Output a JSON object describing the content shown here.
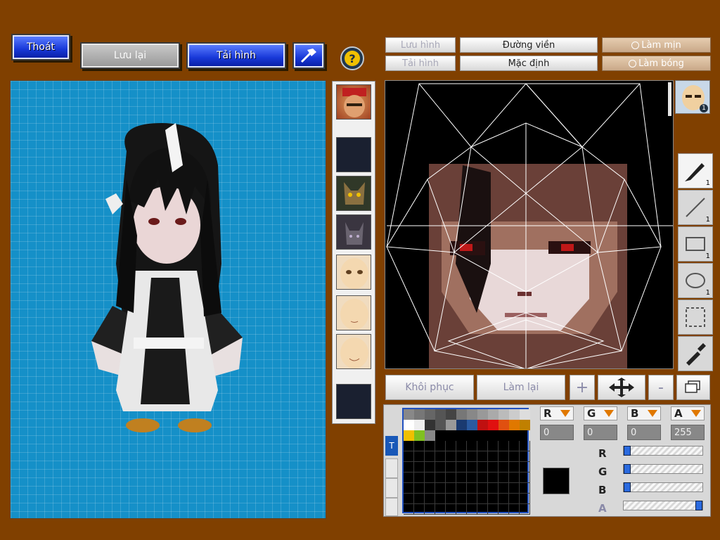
{
  "top_buttons": {
    "exit": "Thoát",
    "save": "Lưu lại",
    "load_image": "Tải hình"
  },
  "editor_toolbar": {
    "save_image": "Lưu hình",
    "load_image": "Tải hình",
    "outline": "Đường viền",
    "default": "Mặc định",
    "smooth": "Làm mịn",
    "shade": "Làm bóng"
  },
  "part_list": [
    "helmet-face",
    "empty",
    "monster-face",
    "creature-face",
    "eyes-face",
    "plain-face",
    "smile-face",
    "empty"
  ],
  "preview_badge": "1",
  "tools": [
    {
      "icon": "brush-icon",
      "count": "1"
    },
    {
      "icon": "line-icon",
      "count": "1"
    },
    {
      "icon": "rectangle-icon",
      "count": "1"
    },
    {
      "icon": "ellipse-icon",
      "count": "1"
    },
    {
      "icon": "selection-icon",
      "count": ""
    },
    {
      "icon": "eyedropper-icon",
      "count": ""
    }
  ],
  "bottom_buttons": {
    "restore": "Khôi phục",
    "redo": "Làm lại",
    "plus": "+",
    "minus": "-"
  },
  "color_channels": {
    "r_label": "R",
    "g_label": "G",
    "b_label": "B",
    "a_label": "A",
    "r_value": "0",
    "g_value": "0",
    "b_value": "0",
    "a_value": "255"
  },
  "slider_levels": {
    "r": 0,
    "g": 0,
    "b": 0,
    "a": 1.0
  },
  "palette_tab": "T",
  "current_color": "#000000",
  "palette_row1": [
    "#888888",
    "#777777",
    "#666666",
    "#555555",
    "#444444",
    "#777777",
    "#888888",
    "#999999",
    "#aaaaaa",
    "#bbbbbb",
    "#cccccc",
    "#dddddd"
  ],
  "palette_row2": [
    "#ffffff",
    "#eeeeee",
    "#333333",
    "#555555",
    "#999999",
    "#1a3a70",
    "#2a5aa0",
    "#c01010",
    "#e01010",
    "#e05010",
    "#e07800",
    "#c08000"
  ],
  "palette_row3": [
    "#f0c000",
    "#80c020",
    "#888888"
  ]
}
